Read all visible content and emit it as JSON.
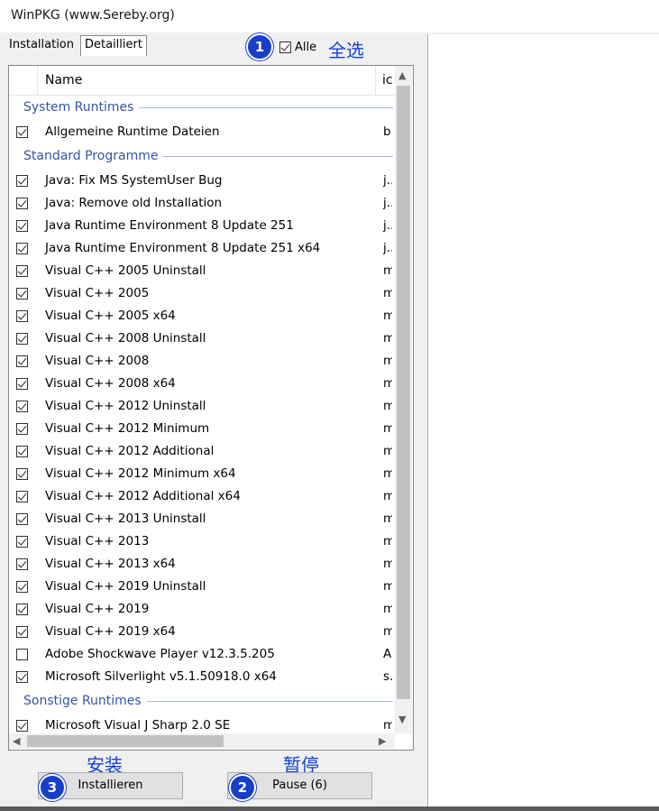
{
  "window": {
    "title": "WinPKG (www.Sereby.org)"
  },
  "tabs": [
    {
      "label": "Installation"
    },
    {
      "label": "Detailliert"
    }
  ],
  "select_all": {
    "label": "Alle",
    "checked": true,
    "annotation": "全选",
    "badge": "1"
  },
  "columns": {
    "name": "Name",
    "id": "ic"
  },
  "groups": [
    {
      "title": "System Runtimes",
      "items": [
        {
          "name": "Allgemeine Runtime Dateien",
          "id": "b",
          "checked": true
        }
      ]
    },
    {
      "title": "Standard Programme",
      "items": [
        {
          "name": "Java: Fix MS SystemUser Bug",
          "id": "j..",
          "checked": true
        },
        {
          "name": "Java: Remove old Installation",
          "id": "j..",
          "checked": true
        },
        {
          "name": "Java Runtime Environment 8 Update 251",
          "id": "j..",
          "checked": true
        },
        {
          "name": "Java Runtime Environment 8 Update 251 x64",
          "id": "j..",
          "checked": true
        },
        {
          "name": "Visual C++ 2005 Uninstall",
          "id": "m",
          "checked": true
        },
        {
          "name": "Visual C++ 2005",
          "id": "m",
          "checked": true
        },
        {
          "name": "Visual C++ 2005 x64",
          "id": "m",
          "checked": true
        },
        {
          "name": "Visual C++ 2008 Uninstall",
          "id": "m",
          "checked": true
        },
        {
          "name": "Visual C++ 2008",
          "id": "m",
          "checked": true
        },
        {
          "name": "Visual C++ 2008 x64",
          "id": "m",
          "checked": true
        },
        {
          "name": "Visual C++ 2012 Uninstall",
          "id": "m",
          "checked": true
        },
        {
          "name": "Visual C++ 2012 Minimum",
          "id": "m",
          "checked": true
        },
        {
          "name": "Visual C++ 2012 Additional",
          "id": "m",
          "checked": true
        },
        {
          "name": "Visual C++ 2012 Minimum x64",
          "id": "m",
          "checked": true
        },
        {
          "name": "Visual C++ 2012 Additional x64",
          "id": "m",
          "checked": true
        },
        {
          "name": "Visual C++ 2013 Uninstall",
          "id": "m",
          "checked": true
        },
        {
          "name": "Visual C++ 2013",
          "id": "m",
          "checked": true
        },
        {
          "name": "Visual C++ 2013 x64",
          "id": "m",
          "checked": true
        },
        {
          "name": "Visual C++ 2019 Uninstall",
          "id": "m",
          "checked": true
        },
        {
          "name": "Visual C++ 2019",
          "id": "m",
          "checked": true
        },
        {
          "name": "Visual C++ 2019 x64",
          "id": "m",
          "checked": true
        },
        {
          "name": "Adobe Shockwave Player v12.3.5.205",
          "id": "A",
          "checked": false
        },
        {
          "name": "Microsoft Silverlight v5.1.50918.0 x64",
          "id": "s.",
          "checked": true
        }
      ]
    },
    {
      "title": "Sonstige Runtimes",
      "items": [
        {
          "name": "Microsoft Visual J Sharp 2.0 SE",
          "id": "m",
          "checked": true
        }
      ]
    }
  ],
  "buttons": {
    "install": {
      "label": "Installieren",
      "annotation": "安装",
      "badge": "3"
    },
    "pause": {
      "label": "Pause (6)",
      "annotation": "暂停",
      "badge": "2"
    }
  },
  "colors": {
    "badge": "#1a3fc7",
    "annotation": "#1340d6",
    "group_header": "#3356a4"
  }
}
